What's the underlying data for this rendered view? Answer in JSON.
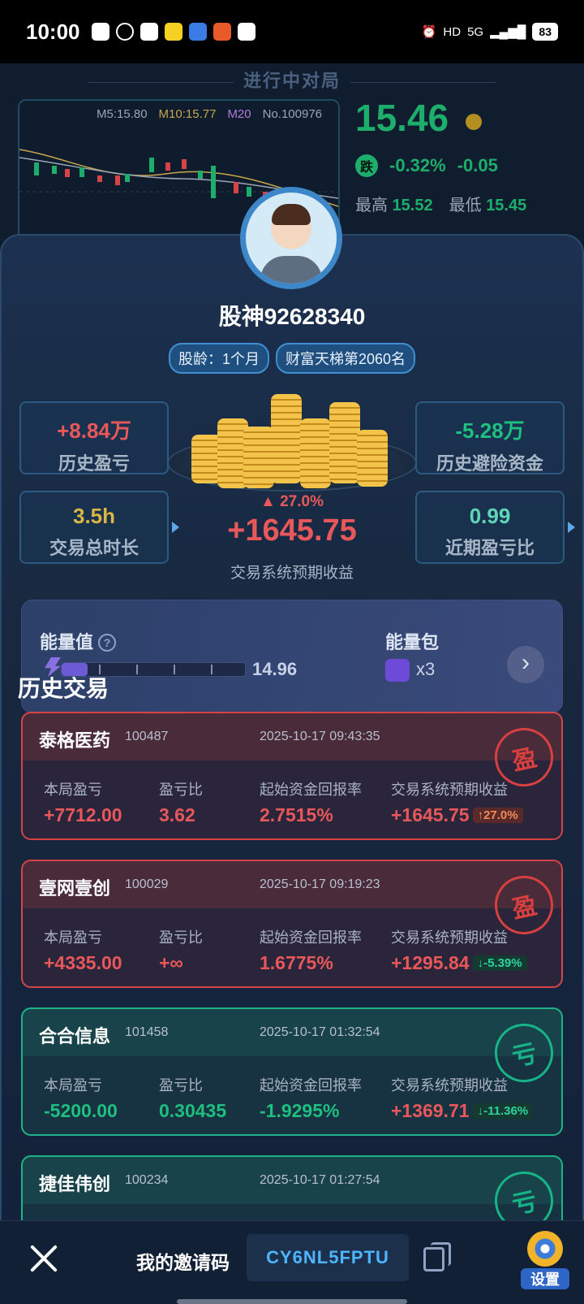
{
  "status_bar": {
    "time": "10:00",
    "network": "5G",
    "battery": "83"
  },
  "game_bg": {
    "title": "进行中对局",
    "ma": {
      "m5": "M5:15.80",
      "m10": "M10:15.77",
      "m20": "M20",
      "code": "No.100976"
    },
    "price": "15.46",
    "change_tag": "跌",
    "change_pct": "-0.32%",
    "change_abs": "-0.05",
    "high_label": "最高",
    "high": "15.52",
    "low_label": "最低",
    "low": "15.45"
  },
  "profile": {
    "username": "股神92628340",
    "tag_age": "股龄：1个月",
    "tag_rank": "财富天梯第2060名"
  },
  "stats": {
    "hist_pnl": {
      "value": "+8.84万",
      "label": "历史盈亏"
    },
    "hist_avoid": {
      "value": "-5.28万",
      "label": "历史避险资金"
    },
    "trade_time": {
      "value": "3.5h",
      "label": "交易总时长"
    },
    "ratio": {
      "value": "0.99",
      "label": "近期盈亏比"
    },
    "center": {
      "pct": "27.0%",
      "value": "+1645.75",
      "label": "交易系统预期收益"
    }
  },
  "energy": {
    "label": "能量值",
    "value": "14.96",
    "fill": 0.14,
    "pack_label": "能量包",
    "pack_count": "x3"
  },
  "history_title": "历史交易",
  "col_labels": {
    "pnl": "本局盈亏",
    "ratio": "盈亏比",
    "roi": "起始资金回报率",
    "expected": "交易系统预期收益"
  },
  "trades": [
    {
      "name": "泰格医药",
      "code": "100487",
      "date": "2025-10-17 09:43:35",
      "pnl": "+7712.00",
      "ratio": "3.62",
      "roi": "2.7515%",
      "expected": "+1645.75",
      "delta": "27.0%",
      "stamp": "盈"
    },
    {
      "name": "壹网壹创",
      "code": "100029",
      "date": "2025-10-17 09:19:23",
      "pnl": "+4335.00",
      "ratio": "+∞",
      "roi": "1.6775%",
      "expected": "+1295.84",
      "delta": "-5.39%",
      "stamp": "盈"
    },
    {
      "name": "合合信息",
      "code": "101458",
      "date": "2025-10-17 01:32:54",
      "pnl": "-5200.00",
      "ratio": "0.30435",
      "roi": "-1.9295%",
      "expected": "+1369.71",
      "delta": "-11.36%",
      "stamp": "亏"
    },
    {
      "name": "捷佳伟创",
      "code": "100234",
      "date": "2025-10-17 01:27:54",
      "stamp": "亏"
    }
  ],
  "bottom": {
    "invite_label": "我的邀请码",
    "invite_code": "CY6NL5FPTU",
    "settings_label": "设置"
  },
  "colors": {
    "win": "#d84348",
    "loss": "#1cb486",
    "accent": "#4db5ff"
  }
}
